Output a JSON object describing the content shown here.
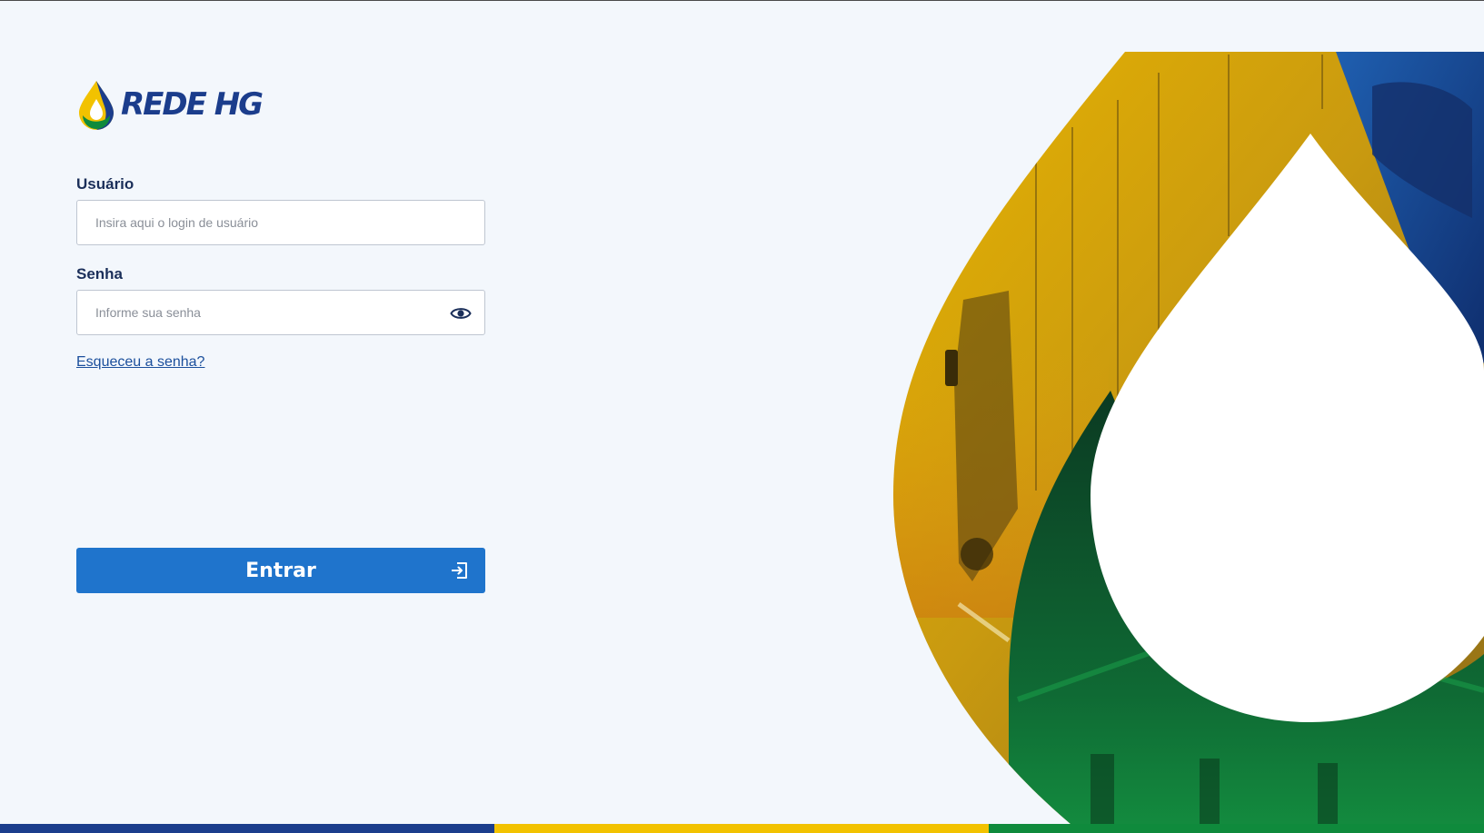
{
  "brand": {
    "logo_text": "REDE HG",
    "logo_icon": "drop-logo-icon",
    "colors": {
      "blue": "#1b3d8c",
      "yellow": "#f2c200",
      "green": "#0f8a3c"
    }
  },
  "form": {
    "user_label": "Usuário",
    "user_placeholder": "Insira aqui o login de usuário",
    "user_value": "",
    "password_label": "Senha",
    "password_placeholder": "Informe sua senha",
    "password_value": "",
    "password_toggle_icon": "eye-icon",
    "forgot_link": "Esqueceu a senha?",
    "submit_label": "Entrar",
    "submit_icon": "login-icon",
    "accent_color": "#1f74cc"
  },
  "hero": {
    "image": "drop-shaped-photo-truck-and-fuel-station",
    "tint_colors": [
      "#f2c200",
      "#1b3d8c",
      "#0f8a3c"
    ]
  },
  "footer_stripe": {
    "colors": [
      "#1b3d8c",
      "#f2c200",
      "#0f8a3c"
    ]
  }
}
